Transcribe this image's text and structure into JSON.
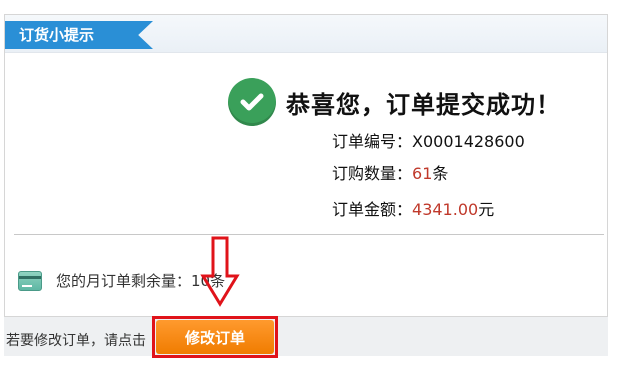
{
  "tab": {
    "label": "订货小提示"
  },
  "success": {
    "message": "恭喜您，订单提交成功！",
    "icon": "check-circle-icon",
    "color": "#3aa05a"
  },
  "order": {
    "number_label": "订单编号：",
    "number_value": "X0001428600",
    "quantity_label": "订购数量：",
    "quantity_value": "61",
    "quantity_unit": "条",
    "amount_label": "订单金额：",
    "amount_value": "4341.00",
    "amount_unit": "元"
  },
  "remaining": {
    "label": "您的月订单剩余量：",
    "value": "10",
    "unit": "条",
    "icon": "card-icon"
  },
  "footer": {
    "hint": "若要修改订单，请点击",
    "modify_button_label": "修改订单"
  },
  "colors": {
    "tab": "#2a8fd6",
    "button": "#f07c00",
    "highlight": "#e0131a",
    "value": "#c0392b"
  }
}
